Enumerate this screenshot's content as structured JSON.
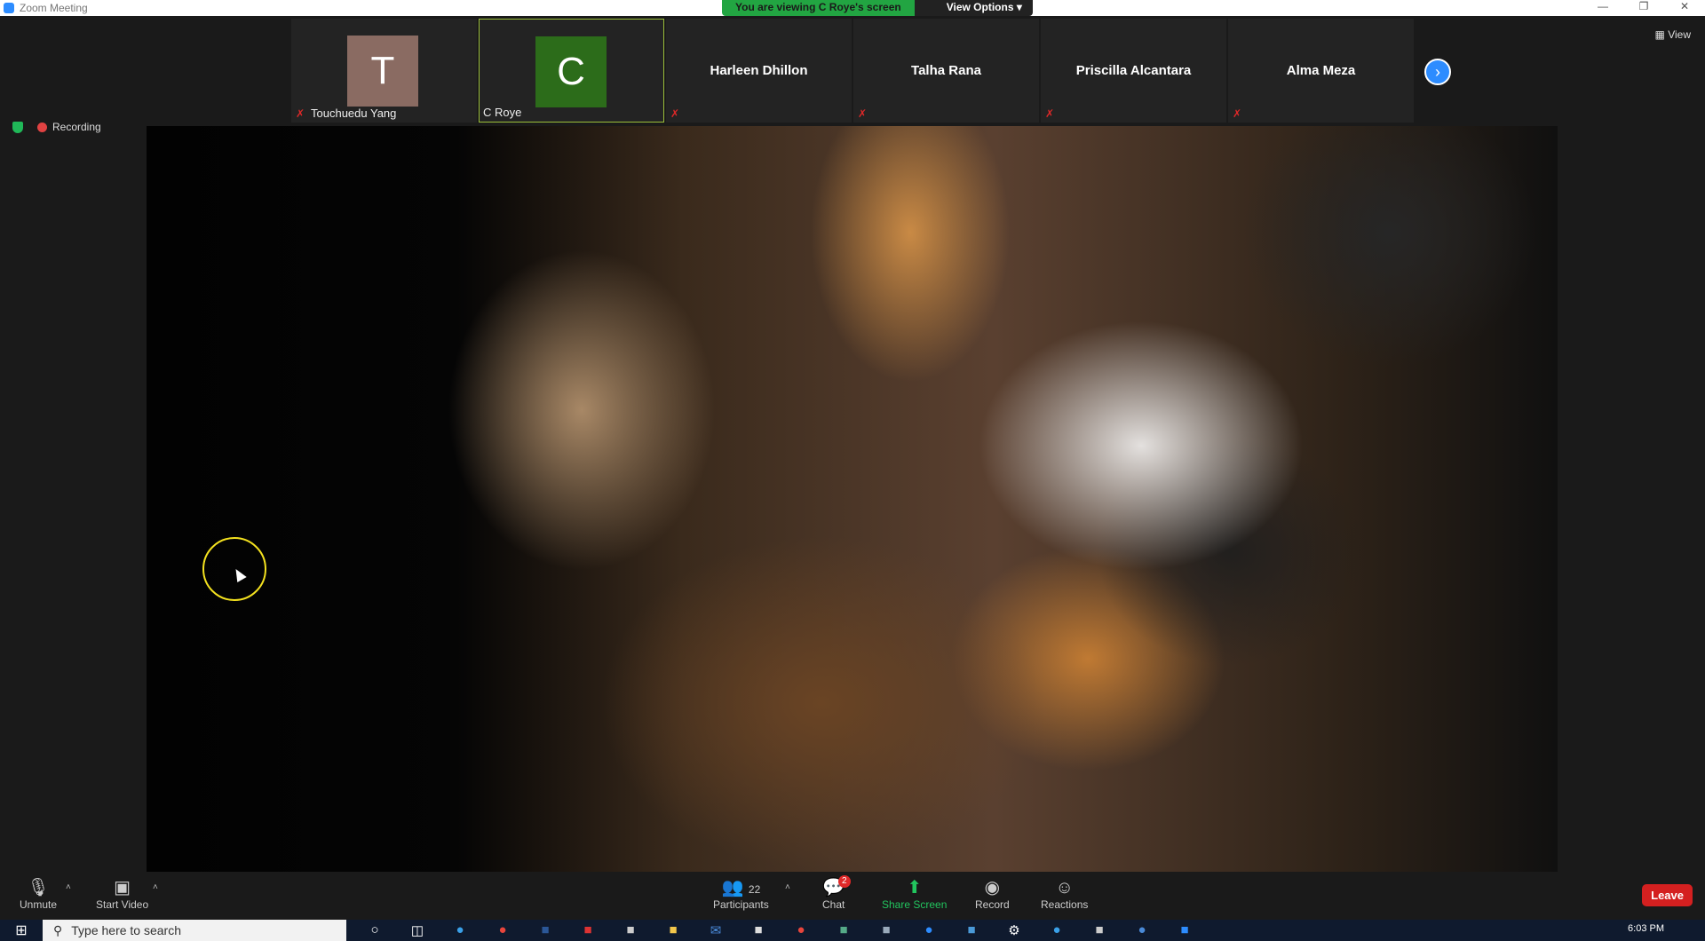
{
  "window": {
    "title": "Zoom Meeting"
  },
  "banner": {
    "message": "You are viewing C Roye's screen",
    "options": "View Options"
  },
  "gallery": {
    "tiles": [
      {
        "initial": "T",
        "name": "Touchuedu Yang",
        "avatar_color": "#8a6b62"
      },
      {
        "initial": "C",
        "name": "C Roye",
        "avatar_color": "#2c6c1a"
      },
      {
        "name": "Harleen Dhillon"
      },
      {
        "name": "Talha Rana"
      },
      {
        "name": "Priscilla Alcantara"
      },
      {
        "name": "Alma Meza"
      }
    ],
    "view_label": "View"
  },
  "recording": {
    "label": "Recording"
  },
  "toolbar": {
    "unmute": "Unmute",
    "start_video": "Start Video",
    "participants_count": "22",
    "participants": "Participants",
    "chat_badge": "2",
    "chat": "Chat",
    "share_screen": "Share Screen",
    "record": "Record",
    "reactions": "Reactions",
    "leave": "Leave"
  },
  "taskbar": {
    "search_placeholder": "Type here to search",
    "time": "6:03 PM"
  },
  "colors": {
    "accent": "#2d8cff",
    "share_green": "#22c55e",
    "leave_red": "#d42020"
  }
}
